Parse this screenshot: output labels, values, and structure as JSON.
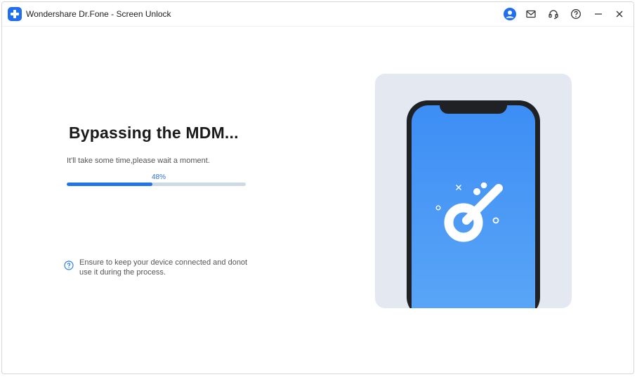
{
  "window": {
    "title": "Wondershare Dr.Fone - Screen Unlock",
    "accent_color": "#1f6ff0"
  },
  "titlebar_icons": [
    "account-icon",
    "mail-icon",
    "headset-support-icon",
    "help-icon",
    "minimize-icon",
    "close-icon"
  ],
  "main": {
    "heading": "Bypassing the MDM...",
    "subtext": "It'll take some time,please wait a moment.",
    "progress": {
      "percent_label": "48%",
      "value": 0.48,
      "fill_color": "#1f74ea",
      "track_color": "#cfd9e4"
    },
    "note": {
      "icon": "question-circle-icon",
      "text": "Ensure to keep your device connected and donot use it during the process."
    }
  },
  "illustration": {
    "description_icon": "key-icon",
    "screen_color": "#3d8ef5"
  }
}
